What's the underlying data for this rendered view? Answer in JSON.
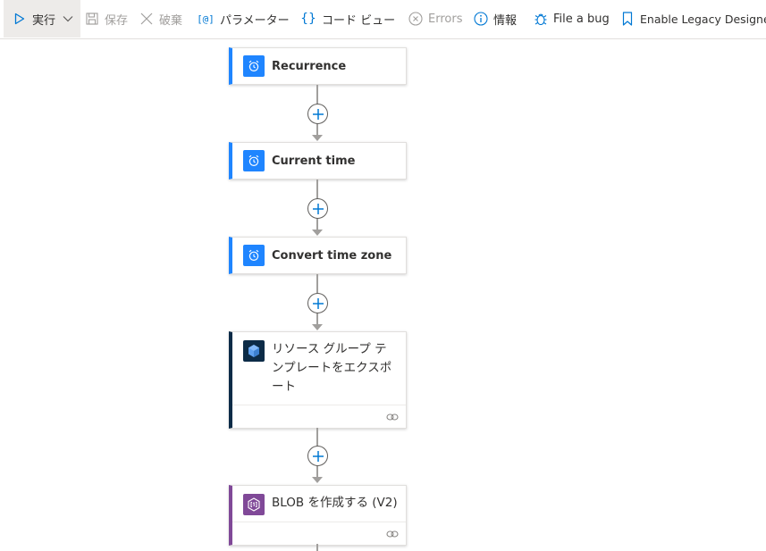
{
  "toolbar": {
    "run_label": "実行",
    "save_label": "保存",
    "discard_label": "破棄",
    "parameters_label": "パラメーター",
    "code_view_label": "コード ビュー",
    "errors_label": "Errors",
    "info_label": "情報",
    "file_bug_label": "File a bug",
    "legacy_label": "Enable Legacy Designer"
  },
  "colors": {
    "accent": "#1f85ff",
    "schedule_icon_bg": "#1f85ff",
    "arm_icon_bg": "#0c2b47",
    "blob_icon_bg": "#804998"
  },
  "workflow": {
    "steps": [
      {
        "title": "Recurrence",
        "icon": "alarm-clock-icon"
      },
      {
        "title": "Current time",
        "icon": "alarm-clock-icon"
      },
      {
        "title": "Convert time zone",
        "icon": "alarm-clock-icon"
      },
      {
        "title": "リソース グループ テンプレートをエクスポート",
        "icon": "resource-cube-icon"
      },
      {
        "title": "BLOB を作成する (V2)",
        "icon": "blob-storage-icon"
      }
    ]
  }
}
